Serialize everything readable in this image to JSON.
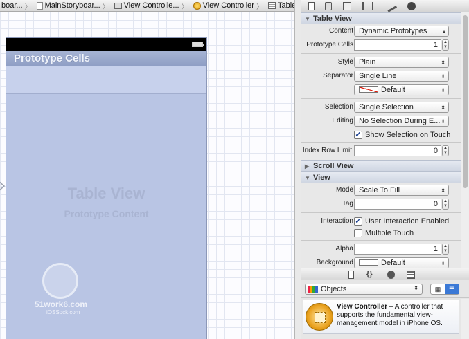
{
  "jumpbar": {
    "crumbs": [
      "boar...",
      "MainStoryboar...",
      "View Controlle...",
      "View Controller",
      "Table View"
    ]
  },
  "canvas": {
    "section_header": "Prototype Cells",
    "table_title": "Table View",
    "table_subtitle": "Prototype Content",
    "watermark": "51work6.com",
    "watermark2": "iOSSock.com"
  },
  "inspector": {
    "table_view_section": "Table View",
    "content_label": "Content",
    "content_value": "Dynamic Prototypes",
    "prototype_cells_label": "Prototype Cells",
    "prototype_cells_value": "1",
    "style_label": "Style",
    "style_value": "Plain",
    "separator_label": "Separator",
    "separator_value": "Single Line",
    "separator_color_value": "Default",
    "selection_label": "Selection",
    "selection_value": "Single Selection",
    "editing_label": "Editing",
    "editing_value": "No Selection During E...",
    "show_selection_label": "Show Selection on Touch",
    "show_selection_checked": true,
    "index_row_limit_label": "Index Row Limit",
    "index_row_limit_value": "0",
    "scroll_view_section": "Scroll View",
    "view_section": "View",
    "mode_label": "Mode",
    "mode_value": "Scale To Fill",
    "tag_label": "Tag",
    "tag_value": "0",
    "interaction_label": "Interaction",
    "user_interaction_label": "User Interaction Enabled",
    "user_interaction_checked": true,
    "multiple_touch_label": "Multiple Touch",
    "multiple_touch_checked": false,
    "alpha_label": "Alpha",
    "alpha_value": "1",
    "background_label": "Background",
    "background_value": "Default"
  },
  "library": {
    "filter_value": "Objects",
    "item_title": "View Controller",
    "item_desc": " – A controller that supports the fundamental view-management model in iPhone OS."
  }
}
